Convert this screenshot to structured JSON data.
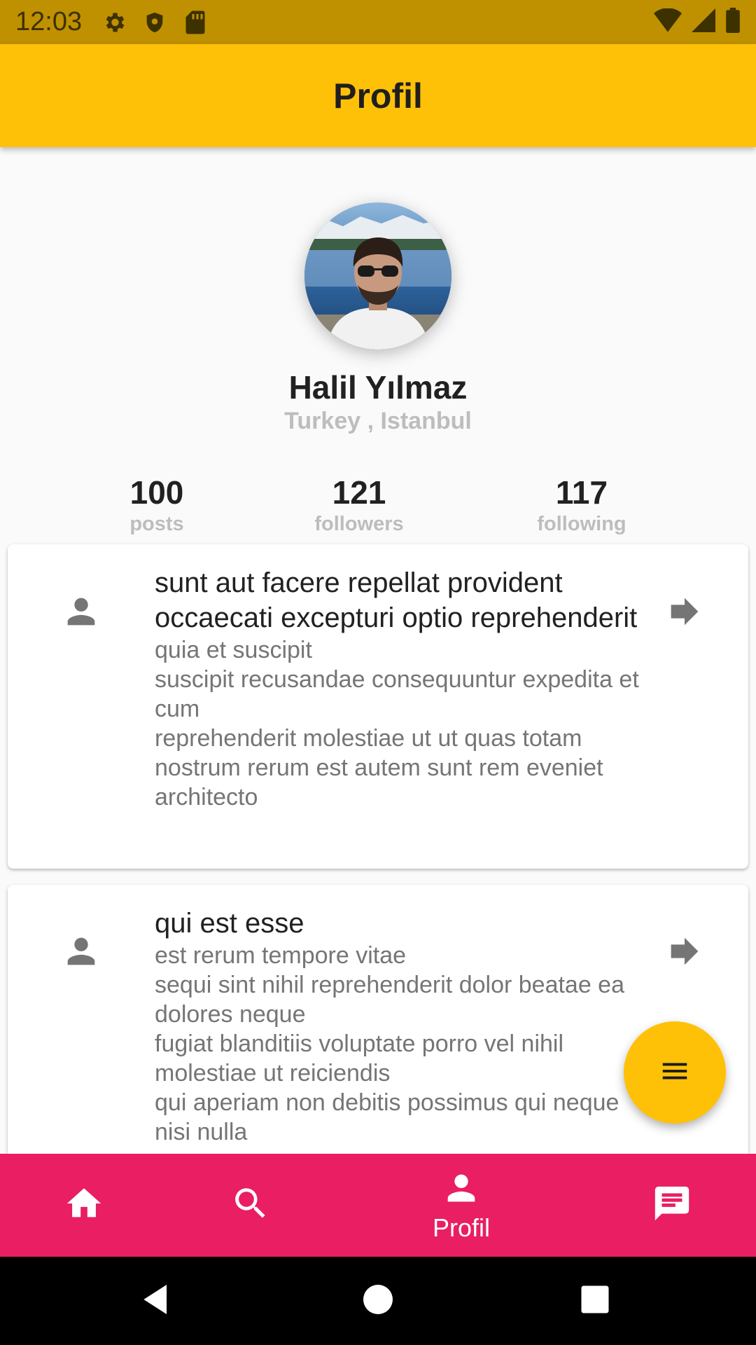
{
  "status_bar": {
    "time": "12:03",
    "icons": [
      "settings-icon",
      "shield-icon",
      "sd-card-icon",
      "wifi-icon",
      "signal-icon",
      "battery-icon"
    ]
  },
  "app_bar": {
    "title": "Profil"
  },
  "profile": {
    "name": "Halil Yılmaz",
    "location": "Turkey , Istanbul"
  },
  "stats": [
    {
      "value": "100",
      "label": "posts"
    },
    {
      "value": "121",
      "label": "followers"
    },
    {
      "value": "117",
      "label": "following"
    }
  ],
  "posts": [
    {
      "title": "sunt aut facere repellat provident occaecati excepturi optio reprehenderit",
      "body": "quia et suscipit\nsuscipit recusandae consequuntur expedita et cum\nreprehenderit molestiae ut ut quas totam\nnostrum rerum est autem sunt rem eveniet architecto"
    },
    {
      "title": "qui est esse",
      "body": "est rerum tempore vitae\nsequi sint nihil reprehenderit dolor beatae ea dolores neque\nfugiat blanditiis voluptate porro vel nihil molestiae ut reiciendis\nqui aperiam non debitis possimus qui neque nisi nulla"
    }
  ],
  "bottom_nav": {
    "items": [
      {
        "icon": "home-icon",
        "label": ""
      },
      {
        "icon": "search-icon",
        "label": ""
      },
      {
        "icon": "person-icon",
        "label": "Profil",
        "active": true
      },
      {
        "icon": "chat-icon",
        "label": ""
      }
    ]
  },
  "colors": {
    "status_bar": "#bf9000",
    "app_bar": "#ffc107",
    "bottom_nav": "#e91e63",
    "fab": "#ffc107"
  }
}
